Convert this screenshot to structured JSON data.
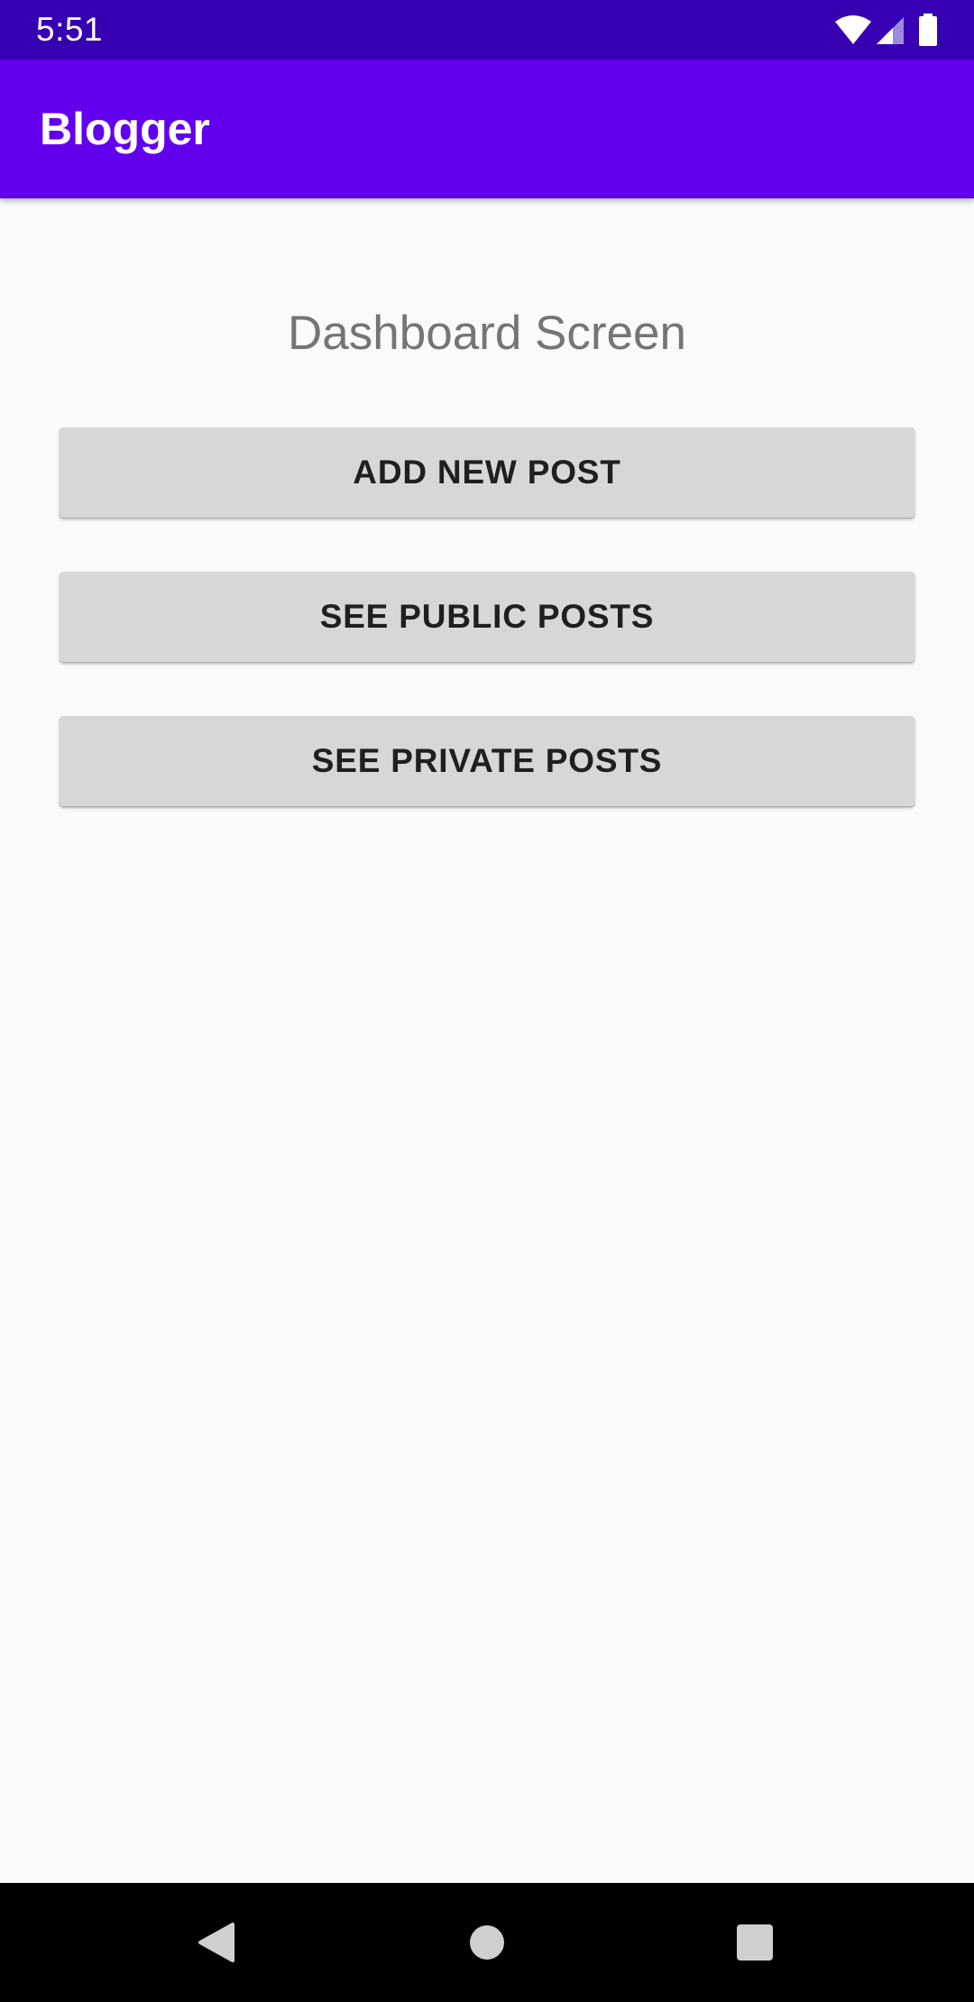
{
  "status_bar": {
    "time": "5:51",
    "icons": [
      "wifi-icon",
      "cellular-signal-icon",
      "battery-icon"
    ]
  },
  "app_bar": {
    "title": "Blogger"
  },
  "dashboard": {
    "heading": "Dashboard Screen",
    "buttons": [
      {
        "label": "ADD NEW POST"
      },
      {
        "label": "SEE PUBLIC POSTS"
      },
      {
        "label": "SEE PRIVATE POSTS"
      }
    ]
  },
  "navigation_bar": {
    "buttons": [
      "back-icon",
      "home-icon",
      "recents-icon"
    ]
  },
  "colors": {
    "status_bar": "#3700B3",
    "primary": "#6200EE",
    "background": "#FAFAFA",
    "button": "#D6D7D7",
    "heading_text": "#757575",
    "nav_bar": "#000000"
  }
}
